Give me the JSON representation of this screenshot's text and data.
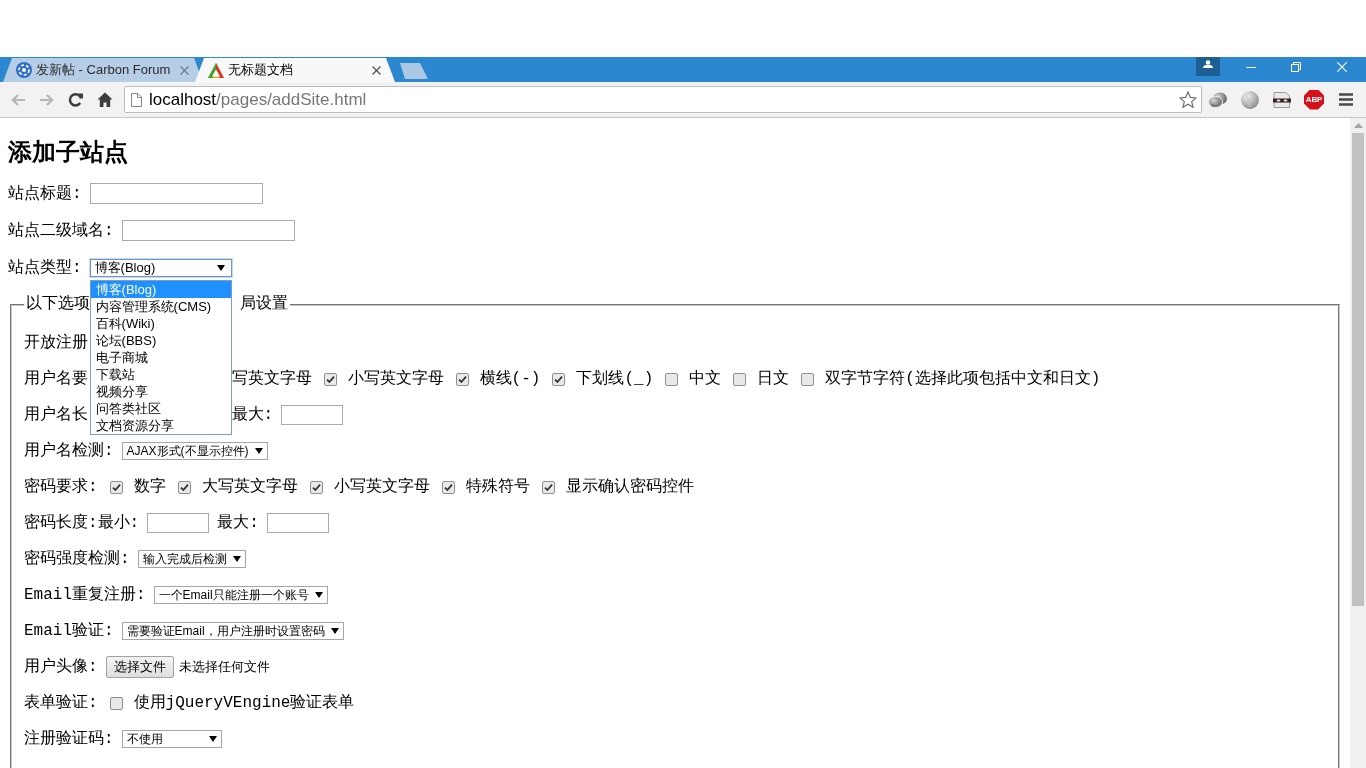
{
  "browser": {
    "tabs": [
      {
        "title": "发新帖 - Carbon Forum",
        "selected": false
      },
      {
        "title": "无标题文档",
        "selected": true
      }
    ],
    "back_disabled": true,
    "forward_disabled": true,
    "address": {
      "host": "localhost",
      "path": "/pages/addSite.html"
    },
    "adblock_label": "ABP"
  },
  "page": {
    "heading": "添加子站点",
    "fields": [
      {
        "kind": "text",
        "label": "站点标题:"
      },
      {
        "kind": "text",
        "label": "站点二级域名:"
      },
      {
        "kind": "select",
        "label": "站点类型:",
        "value": "博客(Blog)",
        "expanded": true,
        "options": [
          {
            "label": "博客(Blog)",
            "selected": true
          },
          {
            "label": "内容管理系统(CMS)",
            "selected": false
          },
          {
            "label": "百科(Wiki)",
            "selected": false
          },
          {
            "label": "论坛(BBS)",
            "selected": false
          },
          {
            "label": "电子商城",
            "selected": false
          },
          {
            "label": "下载站",
            "selected": false
          },
          {
            "label": "视频分享",
            "selected": false
          },
          {
            "label": "问答类社区",
            "selected": false
          },
          {
            "label": "文档资源分享",
            "selected": false
          }
        ]
      }
    ],
    "settings": {
      "legend_parts": [
        "以下选项",
        "局设置"
      ],
      "rows": [
        {
          "label": "开放注册"
        },
        {
          "label": "用户名要",
          "items": [
            {
              "kind": "text",
              "text": "写英文字母"
            },
            {
              "kind": "checkbox",
              "checked": true,
              "label": "小写英文字母"
            },
            {
              "kind": "checkbox",
              "checked": true,
              "label": "横线(-)"
            },
            {
              "kind": "checkbox",
              "checked": true,
              "label": "下划线(_)"
            },
            {
              "kind": "checkbox",
              "checked": false,
              "label": "中文"
            },
            {
              "kind": "checkbox",
              "checked": false,
              "label": "日文"
            },
            {
              "kind": "checkbox",
              "checked": false,
              "label": "双字节字符(选择此项包括中文和日文)"
            }
          ]
        },
        {
          "label": "用户名长",
          "items": [
            {
              "kind": "text",
              "text": "最大:"
            },
            {
              "kind": "input"
            }
          ]
        },
        {
          "label": "用户名检测:",
          "items": [
            {
              "kind": "select",
              "value": "AJAX形式(不显示控件)"
            }
          ]
        },
        {
          "label": "密码要求:",
          "items": [
            {
              "kind": "checkbox",
              "checked": true,
              "label": "数字"
            },
            {
              "kind": "checkbox",
              "checked": true,
              "label": "大写英文字母"
            },
            {
              "kind": "checkbox",
              "checked": true,
              "label": "小写英文字母"
            },
            {
              "kind": "checkbox",
              "checked": true,
              "label": "特殊符号"
            },
            {
              "kind": "checkbox",
              "checked": true,
              "label": "显示确认密码控件"
            }
          ]
        },
        {
          "label": "密码长度:最小:",
          "items": [
            {
              "kind": "input"
            },
            {
              "kind": "text",
              "text": "最大:"
            },
            {
              "kind": "input"
            }
          ]
        },
        {
          "label": "密码强度检测:",
          "items": [
            {
              "kind": "select",
              "value": "输入完成后检测"
            }
          ]
        },
        {
          "label": "Email重复注册:",
          "items": [
            {
              "kind": "select",
              "value": "一个Email只能注册一个账号"
            }
          ]
        },
        {
          "label": "Email验证:",
          "items": [
            {
              "kind": "select",
              "value": "需要验证Email，用户注册时设置密码"
            }
          ]
        },
        {
          "label": "用户头像:",
          "items": [
            {
              "kind": "file",
              "button": "选择文件",
              "status": "未选择任何文件"
            }
          ]
        },
        {
          "label": "表单验证:",
          "items": [
            {
              "kind": "checkbox",
              "checked": false,
              "label": "使用jQueryVEngine验证表单"
            }
          ]
        },
        {
          "label": "注册验证码:",
          "items": [
            {
              "kind": "select",
              "value": "不使用"
            }
          ]
        }
      ]
    }
  }
}
